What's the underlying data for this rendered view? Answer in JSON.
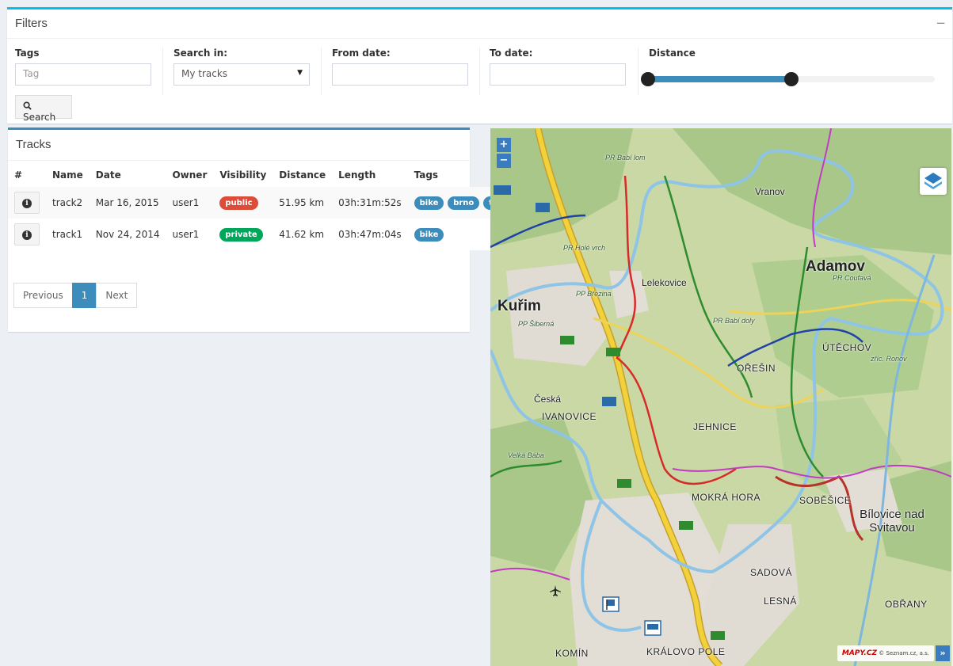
{
  "filters": {
    "title": "Filters",
    "collapse_label": "−",
    "tags_label": "Tags",
    "tags_placeholder": "Tag",
    "search_in_label": "Search in:",
    "search_in_value": "My tracks",
    "from_date_label": "From date:",
    "to_date_label": "To date:",
    "distance_label": "Distance",
    "distance_range": {
      "low_fraction": 0.0,
      "high_fraction": 0.5
    },
    "search_button": "Search",
    "accent_color": "#00c0ef"
  },
  "tracks": {
    "title": "Tracks",
    "columns": [
      "#",
      "Name",
      "Date",
      "Owner",
      "Visibility",
      "Distance",
      "Length",
      "Tags"
    ],
    "rows": [
      {
        "name": "track2",
        "date": "Mar 16, 2015",
        "owner": "user1",
        "visibility": "public",
        "distance": "51.95 km",
        "length": "03h:31m:52s",
        "tags": [
          "bike",
          "brno",
          "track"
        ]
      },
      {
        "name": "track1",
        "date": "Nov 24, 2014",
        "owner": "user1",
        "visibility": "private",
        "distance": "41.62 km",
        "length": "03h:47m:04s",
        "tags": [
          "bike"
        ]
      }
    ],
    "pagination": {
      "previous": "Previous",
      "current": "1",
      "next": "Next"
    },
    "accent_color": "#3c8dbc"
  },
  "map": {
    "zoom_in": "+",
    "zoom_out": "−",
    "attribution_logo": "MAPY.CZ",
    "attribution_text": "© Seznam.cz, a.s.",
    "expand_label": "»",
    "labels": {
      "adamov": "Adamov",
      "kurim": "Kuřim",
      "lelekovice": "Lelekovice",
      "vranov": "Vranov",
      "utechov": "ÚTĚCHOV",
      "oresin": "OŘEŠIN",
      "jehnice": "JEHNICE",
      "ceska": "Česká",
      "ivanovice": "IVANOVICE",
      "mokra_hora": "MOKRÁ HORA",
      "sobesice": "SOBĚŠICE",
      "bilovice": "Bílovice nad Svitavou",
      "sadova": "SADOVÁ",
      "lesna": "LESNÁ",
      "obrany": "OBŘANY",
      "kralovo_pole": "KRÁLOVO POLE",
      "komin": "KOMÍN",
      "pp_babi_lom": "PR Babí lom",
      "pr_babi_doly": "PR Babí doly",
      "pp_brezina": "PP Březina",
      "pp_siberna": "PP Šiberná",
      "pr_hole_vrch": "PR Holé vrch",
      "zric_ronov": "zříc. Ronov",
      "pr_coufava": "PR Coufavá",
      "velka_baba": "Velká Bába"
    },
    "colors": {
      "terrain": "#c9d8a4",
      "forest": "#a8c789",
      "route_blue": "#8ec4e6",
      "road_yellow": "#f2d23a"
    }
  }
}
